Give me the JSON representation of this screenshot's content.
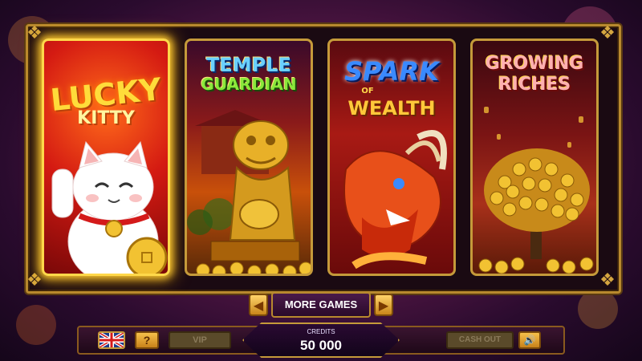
{
  "games": [
    {
      "id": "lucky-kitty",
      "title_line1": "LUCKY",
      "title_line2": "KITTY",
      "selected": true
    },
    {
      "id": "temple-guardian",
      "title_line1": "TEMPLE",
      "title_line2": "GUARDIAN",
      "selected": false
    },
    {
      "id": "spark-of-wealth",
      "title_line1": "SPARK",
      "title_line_mid": "OF",
      "title_line2": "WEALTH",
      "selected": false
    },
    {
      "id": "growing-riches",
      "title_line1": "GROWING",
      "title_line2": "RICHES",
      "selected": false
    }
  ],
  "navigation": {
    "prev_icon": "chevron-left-icon",
    "next_icon": "chevron-right-icon",
    "more_games_label": "MORE GAMES"
  },
  "bottom_bar": {
    "language_icon": "uk-flag-icon",
    "help_label": "?",
    "vip_label": "VIP",
    "credits_label": "CREDITS",
    "credits_value": "50 000",
    "cash_out_label": "CASH OUT",
    "sound_icon": "speaker-icon"
  },
  "colors": {
    "gold": "#c59a3a",
    "selected_glow": "#ffd84a",
    "disabled_button": "#5a4a2a"
  }
}
